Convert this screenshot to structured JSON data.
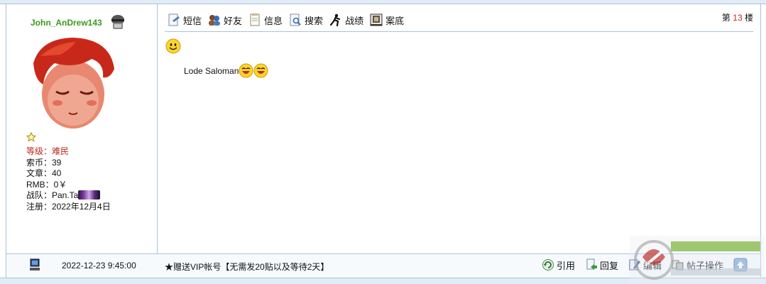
{
  "user": {
    "name": "John_AnDrew143",
    "level_label": "等级：难民",
    "stats": [
      "索币：39",
      "文章：40",
      "RMB：0￥"
    ],
    "team_label": "战队：Pan.Ta",
    "registered": "注册：2022年12月4日"
  },
  "toolbar": {
    "items": [
      {
        "label": "短信",
        "icon": "sms-icon"
      },
      {
        "label": "好友",
        "icon": "friends-icon"
      },
      {
        "label": "信息",
        "icon": "info-icon"
      },
      {
        "label": "搜索",
        "icon": "search-icon"
      },
      {
        "label": "战绩",
        "icon": "record-icon"
      },
      {
        "label": "案底",
        "icon": "file-icon"
      }
    ]
  },
  "floor": {
    "prefix": "第",
    "number": "13",
    "suffix": "楼"
  },
  "post": {
    "text": "Lode Saloman"
  },
  "footer": {
    "time": "2022-12-23 9:45:00",
    "vip_link": "★赠送VIP帐号【无需发20贴以及等待2天】",
    "actions": [
      {
        "label": "引用",
        "icon": "quote-icon"
      },
      {
        "label": "回复",
        "icon": "reply-icon"
      },
      {
        "label": "编辑",
        "icon": "edit-icon"
      },
      {
        "label": "帖子操作",
        "icon": "post-manage-icon"
      }
    ]
  },
  "colors": {
    "username": "#3a9a1c",
    "level": "#c0281c",
    "border": "#a9c3dd",
    "bar": "#e2ecf6"
  }
}
